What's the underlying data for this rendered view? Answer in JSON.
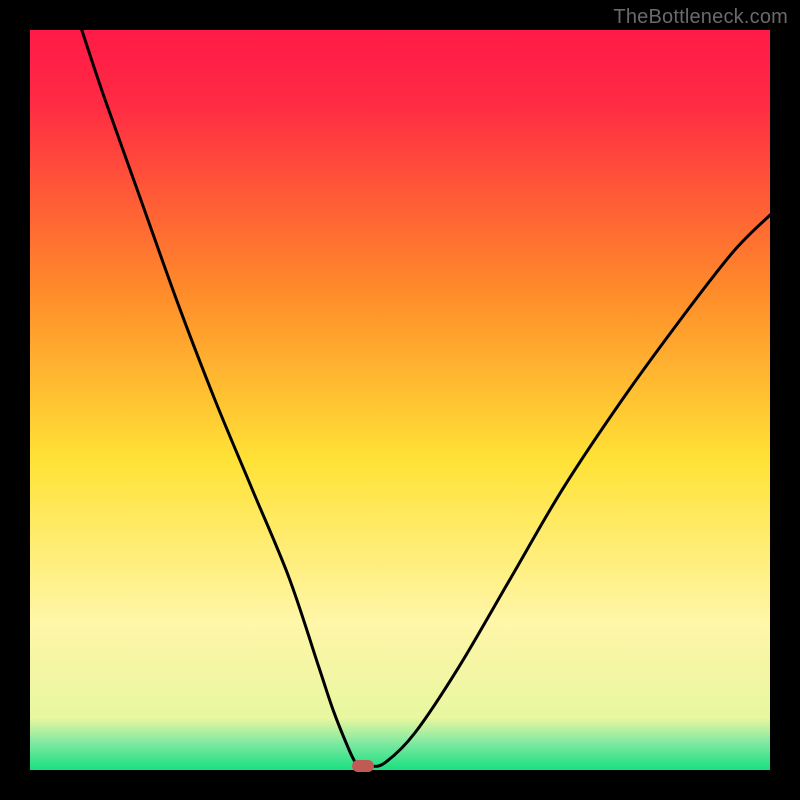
{
  "watermark": "TheBottleneck.com",
  "colors": {
    "frame": "#000000",
    "top": "#ff1a47",
    "orange": "#ff8a2a",
    "yellow": "#ffe236",
    "pale": "#fff6a8",
    "green": "#19e080",
    "curve": "#000000",
    "marker": "#c05a55"
  },
  "chart_data": {
    "type": "line",
    "title": "",
    "xlabel": "",
    "ylabel": "",
    "xlim": [
      0,
      100
    ],
    "ylim": [
      0,
      100
    ],
    "series": [
      {
        "name": "bottleneck-curve",
        "x": [
          7,
          10,
          15,
          20,
          25,
          30,
          35,
          39,
          41,
          43,
          44,
          45,
          46,
          48,
          52,
          58,
          65,
          72,
          80,
          88,
          95,
          100
        ],
        "values": [
          100,
          91,
          77,
          63,
          50,
          38,
          26,
          14,
          8,
          3,
          1,
          0.5,
          0.5,
          1,
          5,
          14,
          26,
          38,
          50,
          61,
          70,
          75
        ]
      }
    ],
    "marker": {
      "x": 45,
      "y": 0.5
    },
    "gradient_stops": [
      {
        "pos": 0.0,
        "color": "#ff1a47"
      },
      {
        "pos": 0.1,
        "color": "#ff2b44"
      },
      {
        "pos": 0.35,
        "color": "#ff8a2a"
      },
      {
        "pos": 0.58,
        "color": "#ffe236"
      },
      {
        "pos": 0.8,
        "color": "#fff6a8"
      },
      {
        "pos": 0.93,
        "color": "#e8f7a0"
      },
      {
        "pos": 0.965,
        "color": "#7be8a0"
      },
      {
        "pos": 1.0,
        "color": "#19e080"
      }
    ]
  }
}
